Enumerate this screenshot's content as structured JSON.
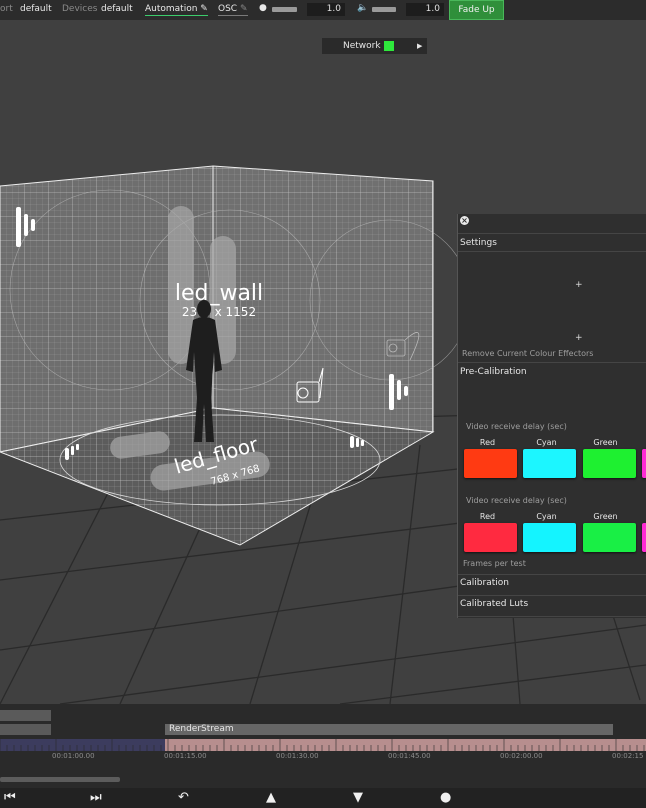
{
  "topbar": {
    "port_label": "ort",
    "port_value": "default",
    "devices_label": "Devices",
    "devices_value": "default",
    "automation_label": "Automation",
    "osc_label": "OSC",
    "value_1": "1.0",
    "value_2": "1.0",
    "fade_up_label": "Fade Up"
  },
  "network": {
    "label": "Network",
    "status_color": "#2ee83c"
  },
  "scene": {
    "wall_name": "led_wall",
    "wall_size": "23_4 x 1152",
    "floor_name": "led_floor",
    "floor_size": "768 x 768"
  },
  "panel": {
    "settings_title": "Settings",
    "plus_1": "+",
    "plus_2": "+",
    "remove_effectors": "Remove Current Colour Effectors",
    "precal_title": "Pre-Calibration",
    "group1_label": "Video receive delay (sec)",
    "group2_label": "Video receive delay (sec)",
    "swatches1": [
      {
        "label": "Red",
        "color": "#ff3a12"
      },
      {
        "label": "Cyan",
        "color": "#1cf6ff"
      },
      {
        "label": "Green",
        "color": "#1ef030"
      }
    ],
    "swatches2": [
      {
        "label": "Red",
        "color": "#ff2a40"
      },
      {
        "label": "Cyan",
        "color": "#14f4ff"
      },
      {
        "label": "Green",
        "color": "#19ef45"
      }
    ],
    "frames_label": "Frames per test",
    "calibration_title": "Calibration",
    "luts_title": "Calibrated Luts"
  },
  "timeline": {
    "track_label": "RenderStream",
    "times": [
      "00:01:00.00",
      "00:01:15.00",
      "00:01:30.00",
      "00:01:45.00",
      "00:02:00.00",
      "00:02:15"
    ]
  },
  "transport": {
    "prev_icon": "skip-back-icon",
    "next_icon": "skip-forward-icon",
    "loop_icon": "return-icon",
    "up_icon": "triangle-up-icon",
    "down_icon": "triangle-down-icon",
    "record_icon": "record-icon"
  }
}
